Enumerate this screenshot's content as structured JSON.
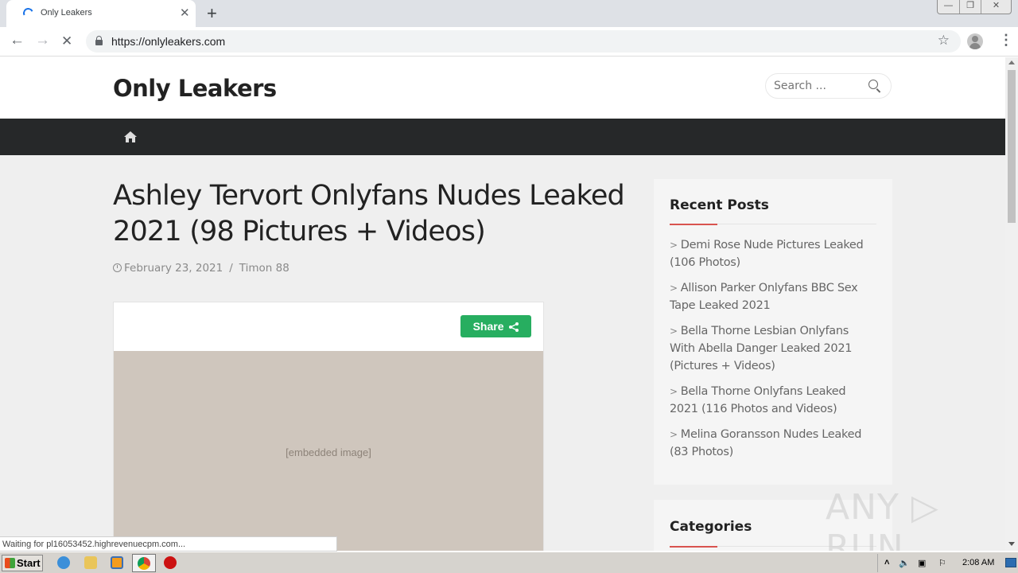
{
  "browser": {
    "tab_title": "Only Leakers",
    "url": "https://onlyleakers.com",
    "new_tab_glyph": "+",
    "tab_close_glyph": "✕",
    "back_glyph": "←",
    "forward_glyph": "→",
    "stop_glyph": "✕",
    "star_glyph": "☆",
    "menu_glyph": "⋮",
    "window_controls": {
      "minimize": "—",
      "restore": "❐",
      "close": "✕"
    },
    "status_text": "Waiting for pl16053452.highrevenuecpm.com..."
  },
  "site": {
    "title": "Only Leakers",
    "search_placeholder": "Search ..."
  },
  "post": {
    "title": "Ashley Tervort Onlyfans Nudes Leaked 2021 (98 Pictures + Videos)",
    "date": "February 23, 2021",
    "separator": "/",
    "author": "Timon 88",
    "share_label": "Share",
    "media_label": "[embedded image]"
  },
  "sidebar": {
    "recent_posts": {
      "heading": "Recent Posts",
      "arrow_glyph": ">",
      "items": [
        {
          "label": "Demi Rose Nude Pictures Leaked (106 Photos)"
        },
        {
          "label": "Allison Parker Onlyfans BBC Sex Tape Leaked 2021"
        },
        {
          "label": "Bella Thorne Lesbian Onlyfans With Abella Danger Leaked 2021 (Pictures + Videos)"
        },
        {
          "label": "Bella Thorne Onlyfans Leaked 2021 (116 Photos and Videos)"
        },
        {
          "label": "Melina Goransson Nudes Leaked (83 Photos)"
        }
      ]
    },
    "categories": {
      "heading": "Categories"
    }
  },
  "watermark": "ANY ▷ RUN",
  "taskbar": {
    "start_label": "Start",
    "clock": "2:08 AM",
    "tray_up_glyph": "˄"
  },
  "colors": {
    "accent_red": "#d9534f",
    "share_green": "#27ae60",
    "navbar_dark": "#262829"
  }
}
